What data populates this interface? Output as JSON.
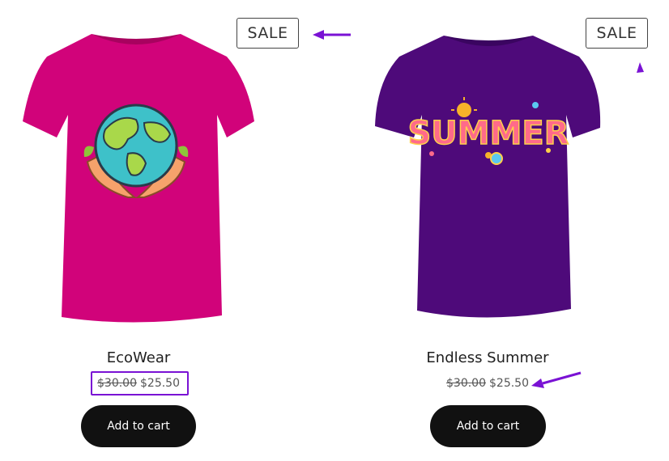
{
  "products": [
    {
      "title": "EcoWear",
      "sale_badge": "SALE",
      "old_price": "$30.00",
      "new_price": "$25.50",
      "button_label": "Add to cart",
      "shirt_color": "#d1037a",
      "graphic": "globe-in-hands"
    },
    {
      "title": "Endless Summer",
      "sale_badge": "SALE",
      "old_price": "$30.00",
      "new_price": "$25.50",
      "button_label": "Add to cart",
      "shirt_color": "#4e0a7a",
      "graphic": "summer-lettering",
      "graphic_text": "SUMMER"
    }
  ],
  "annotation_color": "#7a12d4"
}
